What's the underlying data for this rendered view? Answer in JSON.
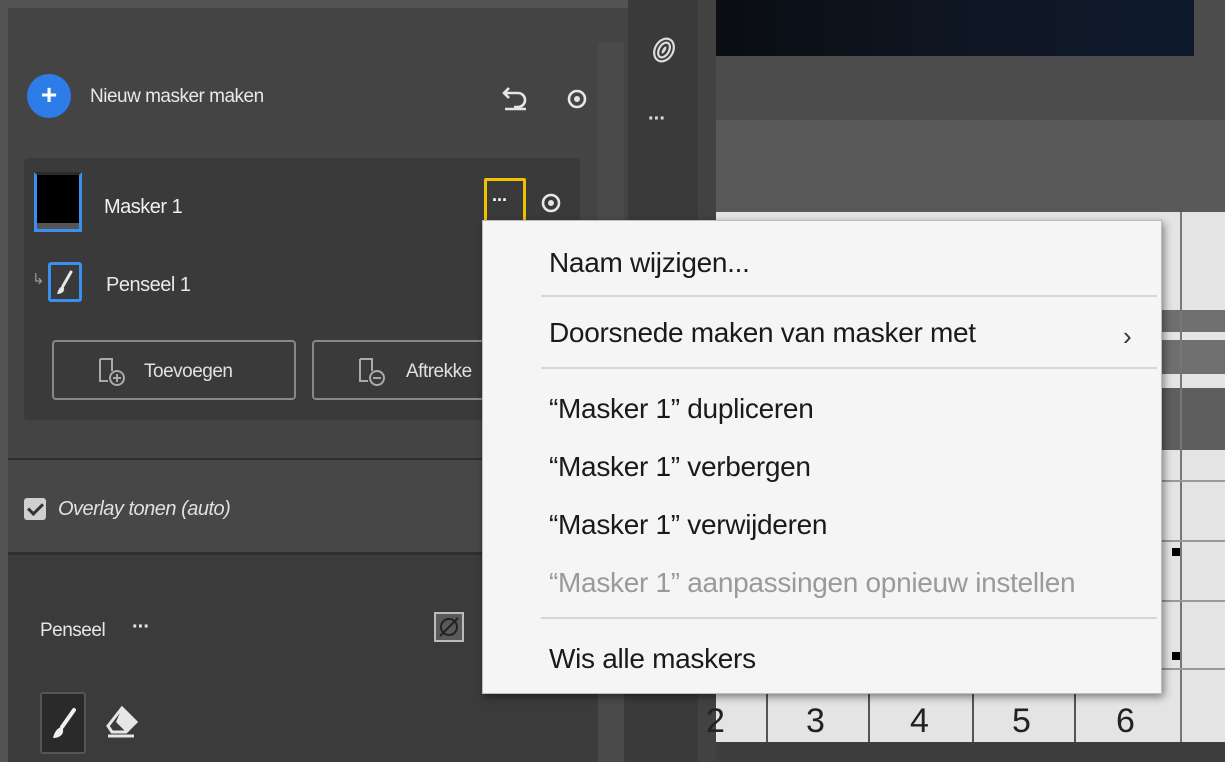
{
  "masks_panel": {
    "new_mask_label": "Nieuw masker maken",
    "new_mask_icon": "+",
    "mask": {
      "name": "Masker 1",
      "more_icon": "···",
      "subitem_name": "Penseel 1"
    },
    "add_button_label": "Toevoegen",
    "subtract_button_label": "Aftrekke",
    "overlay_checkbox_label": "Overlay tonen (auto)",
    "overlay_checked": true,
    "brush_section_label": "Penseel",
    "brush_section_more": "···",
    "accent_color": "#2d7de8",
    "highlight_color": "#f2c200"
  },
  "tool_strip": {
    "more_icon": "···"
  },
  "canvas": {
    "column_numbers": [
      "2",
      "3",
      "4",
      "5",
      "6"
    ]
  },
  "context_menu": {
    "items": [
      {
        "label": "Naam wijzigen...",
        "enabled": true
      },
      {
        "label": "Doorsnede maken van masker met",
        "enabled": true,
        "submenu_chevron": "›"
      },
      {
        "label": "“Masker 1” dupliceren",
        "enabled": true
      },
      {
        "label": "“Masker 1” verbergen",
        "enabled": true
      },
      {
        "label": "“Masker 1” verwijderen",
        "enabled": true
      },
      {
        "label": "“Masker 1” aanpassingen opnieuw instellen",
        "enabled": false
      },
      {
        "label": "Wis alle maskers",
        "enabled": true
      }
    ]
  }
}
